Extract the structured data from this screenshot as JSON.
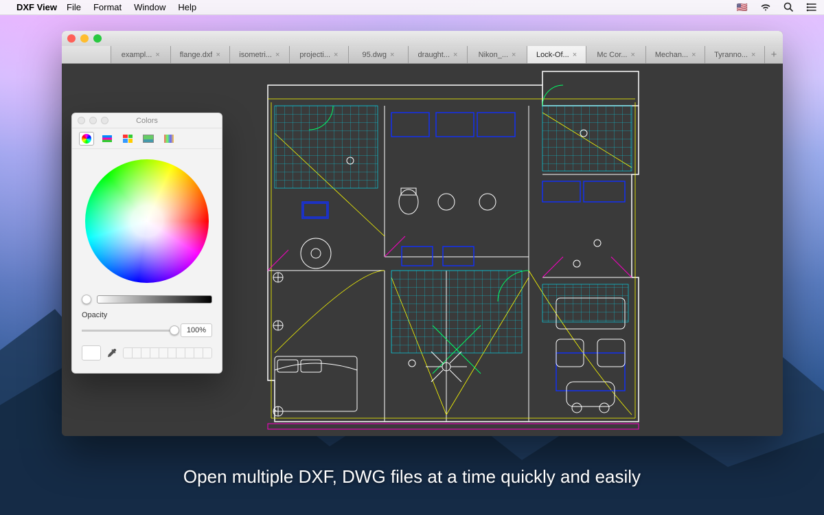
{
  "menubar": {
    "app_name": "DXF View",
    "items": [
      "File",
      "Format",
      "Window",
      "Help"
    ]
  },
  "tabs": [
    {
      "label": "exampl...",
      "active": false
    },
    {
      "label": "flange.dxf",
      "active": false
    },
    {
      "label": "isometri...",
      "active": false
    },
    {
      "label": "projecti...",
      "active": false
    },
    {
      "label": "95.dwg",
      "active": false
    },
    {
      "label": "draught...",
      "active": false
    },
    {
      "label": "Nikon_...",
      "active": false
    },
    {
      "label": "Lock-Of...",
      "active": true
    },
    {
      "label": "Mc Cor...",
      "active": false
    },
    {
      "label": "Mechan...",
      "active": false
    },
    {
      "label": "Tyranno...",
      "active": false
    }
  ],
  "colors_panel": {
    "title": "Colors",
    "opacity_label": "Opacity",
    "opacity_value": "100%"
  },
  "caption": "Open multiple DXF, DWG files at a time quickly and easily"
}
